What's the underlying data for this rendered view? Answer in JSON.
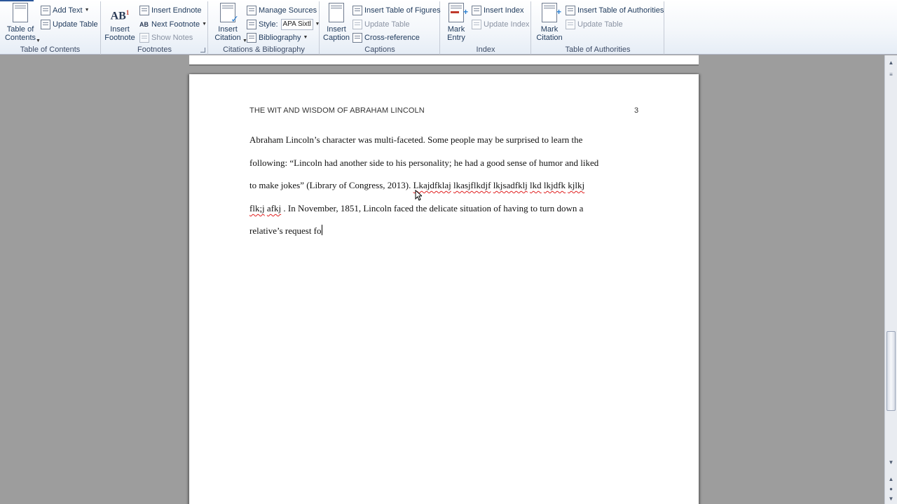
{
  "ribbon": {
    "table_of_contents": {
      "toc_label": "Table of\nContents",
      "add_text": "Add Text",
      "update_table": "Update Table",
      "group_label": "Table of Contents"
    },
    "footnotes": {
      "insert_footnote": "Insert\nFootnote",
      "insert_endnote": "Insert Endnote",
      "next_footnote": "Next Footnote",
      "show_notes": "Show Notes",
      "group_label": "Footnotes",
      "icon_text": "AB"
    },
    "citations": {
      "insert_citation": "Insert\nCitation",
      "manage_sources": "Manage Sources",
      "style_label": "Style:",
      "style_value": "APA Sixtl",
      "bibliography": "Bibliography",
      "group_label": "Citations & Bibliography"
    },
    "captions": {
      "insert_caption": "Insert\nCaption",
      "insert_table_of_figures": "Insert Table of Figures",
      "update_table": "Update Table",
      "cross_reference": "Cross-reference",
      "group_label": "Captions"
    },
    "index": {
      "mark_entry": "Mark\nEntry",
      "insert_index": "Insert Index",
      "update_index": "Update Index",
      "group_label": "Index"
    },
    "authorities": {
      "mark_citation": "Mark\nCitation",
      "insert_table_of_authorities": "Insert Table of Authorities",
      "update_table": "Update Table",
      "group_label": "Table of Authorities"
    }
  },
  "document": {
    "header": "THE WIT AND WISDOM OF ABRAHAM LINCOLN",
    "page_number": "3",
    "lines": {
      "l1": "Abraham Lincoln’s character was multi-faceted.  Some people may be surprised to learn the",
      "l2": "following:  “Lincoln had another side to his personality; he had a good sense of humor and liked",
      "l3_a": "to make jokes” (Library of Congress, 2013).  ",
      "l3_b": "Lkajdfklaj",
      "l3_c": " ",
      "l3_d": "lkasjflkdjf",
      "l3_e": "  ",
      "l3_f": "lkjsadfklj",
      "l3_g": " ",
      "l3_h": "lkd",
      "l3_i": " ",
      "l3_j": "lkjdfk",
      "l3_k": "  ",
      "l3_l": "kjlkj",
      "l4_a": "flk;j",
      "l4_b": " ",
      "l4_c": "afkj",
      "l4_d": " .  In November, 1851, Lincoln faced the delicate situation of having to turn down a",
      "l5": "relative’s request fo"
    }
  },
  "colors": {
    "ribbon_text": "#1e395b",
    "spelling_error": "#e02020",
    "workspace": "#9d9d9d"
  }
}
